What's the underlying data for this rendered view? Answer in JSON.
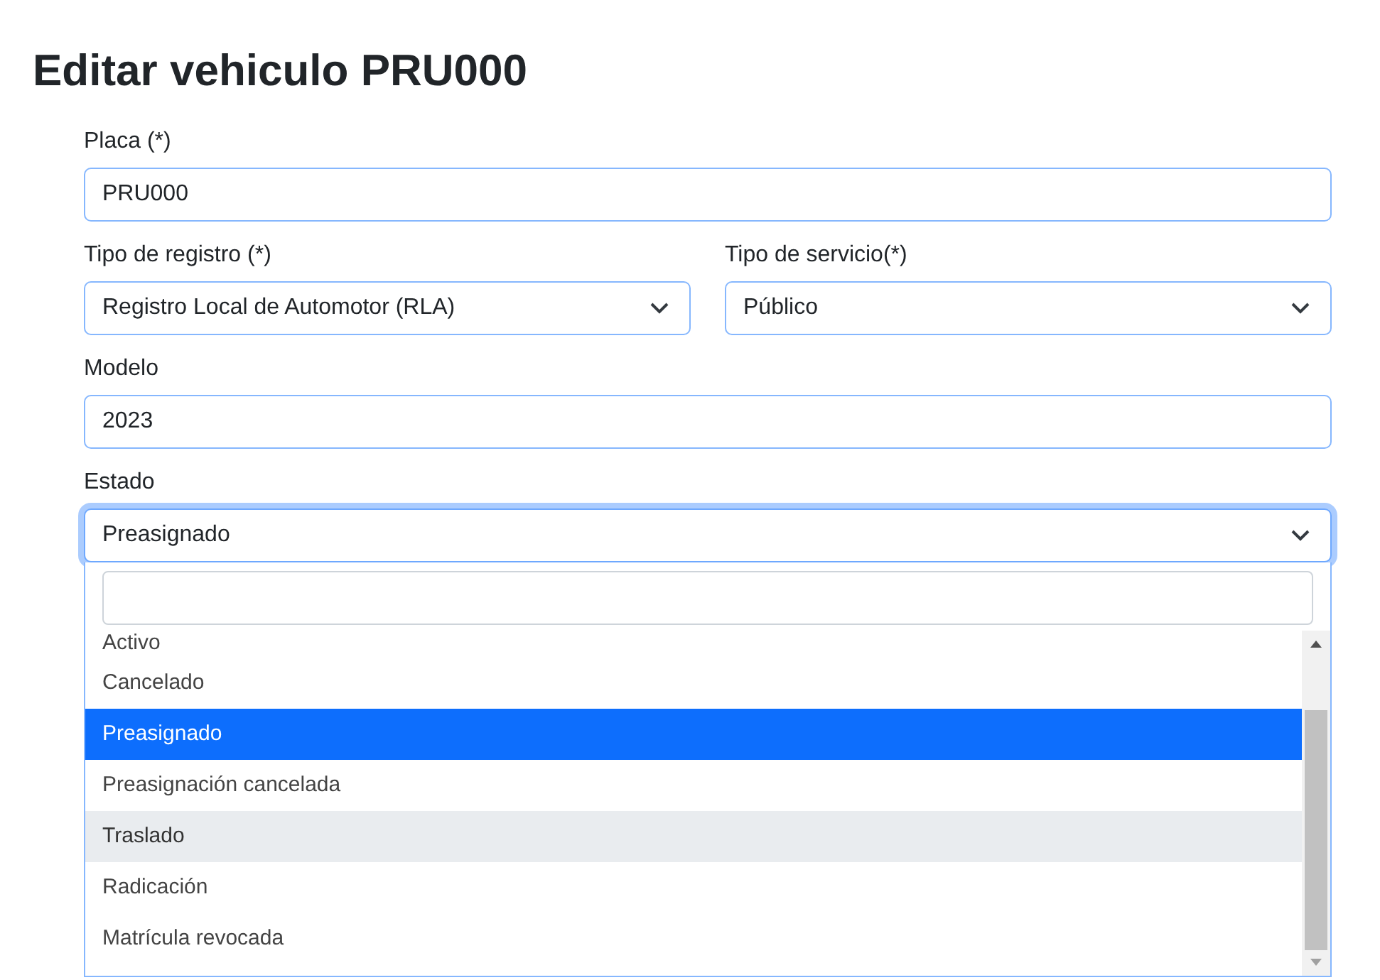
{
  "title": "Editar vehiculo PRU000",
  "fields": [
    {
      "kind": "text",
      "label": "Placa (*)",
      "value": "PRU000",
      "focused": false
    },
    {
      "kind": "select-pair",
      "items": [
        {
          "label": "Tipo de registro (*)",
          "value": "Registro Local de Automotor (RLA)"
        },
        {
          "label": "Tipo de servicio(*)",
          "value": "Público"
        }
      ]
    },
    {
      "kind": "text",
      "label": "Modelo",
      "value": "2023",
      "focused": false
    },
    {
      "kind": "select",
      "label": "Estado",
      "value": "Preasignado",
      "focused": true,
      "expanded": true,
      "options": [
        {
          "label": "Activo",
          "selected": false,
          "hovered": false
        },
        {
          "label": "Cancelado",
          "selected": false,
          "hovered": false
        },
        {
          "label": "Preasignado",
          "selected": true,
          "hovered": false
        },
        {
          "label": "Preasignación cancelada",
          "selected": false,
          "hovered": false
        },
        {
          "label": "Traslado",
          "selected": false,
          "hovered": true
        },
        {
          "label": "Radicación",
          "selected": false,
          "hovered": false
        },
        {
          "label": "Matrícula revocada",
          "selected": false,
          "hovered": false
        }
      ]
    }
  ]
}
